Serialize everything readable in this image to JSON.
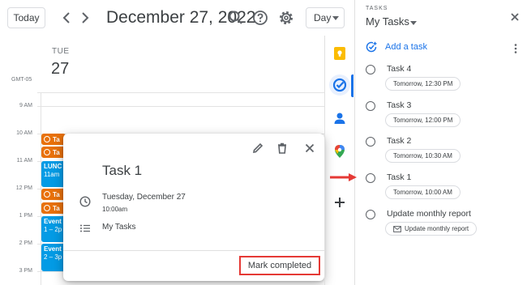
{
  "header": {
    "today_label": "Today",
    "date_title": "December 27, 2022",
    "view_label": "Day"
  },
  "day": {
    "weekday": "TUE",
    "day_number": "27",
    "timezone": "GMT-05",
    "hours": [
      "9 AM",
      "10 AM",
      "11 AM",
      "12 PM",
      "1 PM",
      "2 PM",
      "3 PM"
    ]
  },
  "events": {
    "task_a": "Ta",
    "task_b": "Ta",
    "lunch_title": "LUNC",
    "lunch_time": "11am",
    "task_c": "Ta",
    "task_d": "Ta",
    "event1_title": "Event",
    "event1_time": "1 – 2p",
    "event2_title": "Event",
    "event2_time": "2 – 3p"
  },
  "popup": {
    "title": "Task 1",
    "date": "Tuesday, December 27",
    "time": "10:00am",
    "list": "My Tasks",
    "mark_completed": "Mark completed"
  },
  "tasks_panel": {
    "caption": "TASKS",
    "title": "My Tasks",
    "add_task": "Add a task",
    "items": [
      {
        "name": "Task 4",
        "chip": "Tomorrow, 12:30 PM"
      },
      {
        "name": "Task 3",
        "chip": "Tomorrow, 12:00 PM"
      },
      {
        "name": "Task 2",
        "chip": "Tomorrow, 10:30 AM"
      },
      {
        "name": "Task 1",
        "chip": "Tomorrow, 10:00 AM"
      },
      {
        "name": "Update monthly report",
        "chip": "Update monthly report"
      }
    ]
  },
  "colors": {
    "accent_blue": "#1a73e8",
    "task_orange": "#e8710a",
    "event_blue": "#039be5",
    "highlight_red": "#e53935"
  }
}
